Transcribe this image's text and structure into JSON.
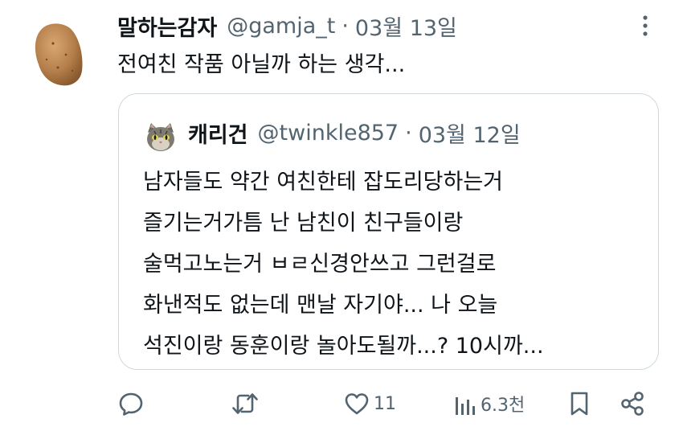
{
  "tweet": {
    "author_name": "말하는감자",
    "author_handle": "@gamja_t",
    "separator": "·",
    "date": "03월 13일",
    "text": "전여친 작품 아닐까 하는 생각..."
  },
  "quoted_tweet": {
    "author_name": "캐리건",
    "author_handle": "@twinkle857",
    "separator": "·",
    "date": "03월 12일",
    "lines": [
      "남자들도 약간 여친한테 잡도리당하는거",
      "즐기는거가틈 난 남친이 친구들이랑",
      "술먹고노는거 ㅂㄹ신경안쓰고 그런걸로",
      "화낸적도 없는데 맨날 자기야... 나 오늘",
      "석진이랑 동훈이랑 놀아도될까...? 10시까..."
    ]
  },
  "actions": {
    "reply": {
      "icon": "reply-icon"
    },
    "retweet": {
      "icon": "retweet-icon"
    },
    "like": {
      "icon": "heart-icon",
      "count": "11"
    },
    "views": {
      "icon": "views-icon",
      "count": "6.3천"
    },
    "bookmark": {
      "icon": "bookmark-icon"
    },
    "share": {
      "icon": "share-icon"
    }
  },
  "colors": {
    "text": "#0f1419",
    "secondary": "#536471",
    "border": "#cfd9de"
  }
}
